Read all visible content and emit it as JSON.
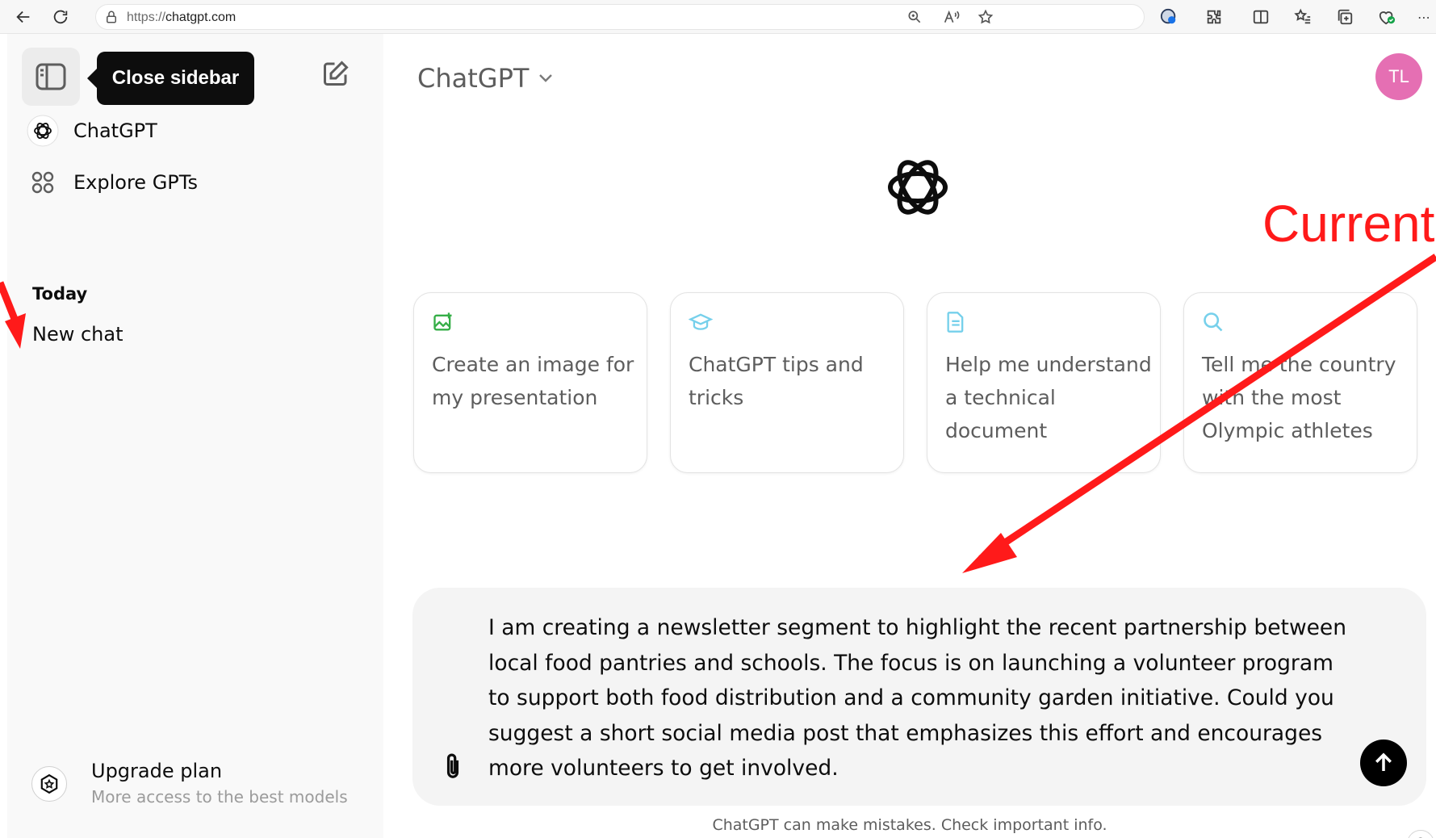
{
  "browser": {
    "url_scheme": "https://",
    "url_host": "chatgpt.com"
  },
  "sidebar": {
    "tooltip": "Close sidebar",
    "items": [
      {
        "label": "ChatGPT",
        "icon": "openai-logo-icon"
      },
      {
        "label": "Explore GPTs",
        "icon": "grid-icon"
      }
    ],
    "section_today": "Today",
    "chats": [
      "New chat"
    ],
    "upgrade": {
      "title": "Upgrade plan",
      "subtitle": "More access to the best models"
    }
  },
  "header": {
    "model": "ChatGPT",
    "avatar_initials": "TL",
    "avatar_color": "#e56fb3"
  },
  "suggestions": [
    {
      "text": "Create an image for my presentation",
      "icon": "image-icon",
      "color": "#35ae47"
    },
    {
      "text": "ChatGPT tips and tricks",
      "icon": "graduation-cap-icon",
      "color": "#76d0eb"
    },
    {
      "text": "Help me understand a technical document",
      "icon": "document-icon",
      "color": "#76d0eb"
    },
    {
      "text": "Tell me the country with the most Olympic athletes",
      "icon": "search-icon",
      "color": "#76d0eb"
    }
  ],
  "composer": {
    "value": "I am creating a newsletter segment to highlight the recent partnership between local food pantries and schools. The focus is on launching a volunteer program to support both food distribution and a community garden initiative. Could you suggest a short social media post that emphasizes this effort and encourages more volunteers to get involved."
  },
  "disclaimer": "ChatGPT can make mistakes. Check important info.",
  "help_label": "?",
  "annotation": {
    "label": "Current",
    "color": "#ff1a1a"
  }
}
